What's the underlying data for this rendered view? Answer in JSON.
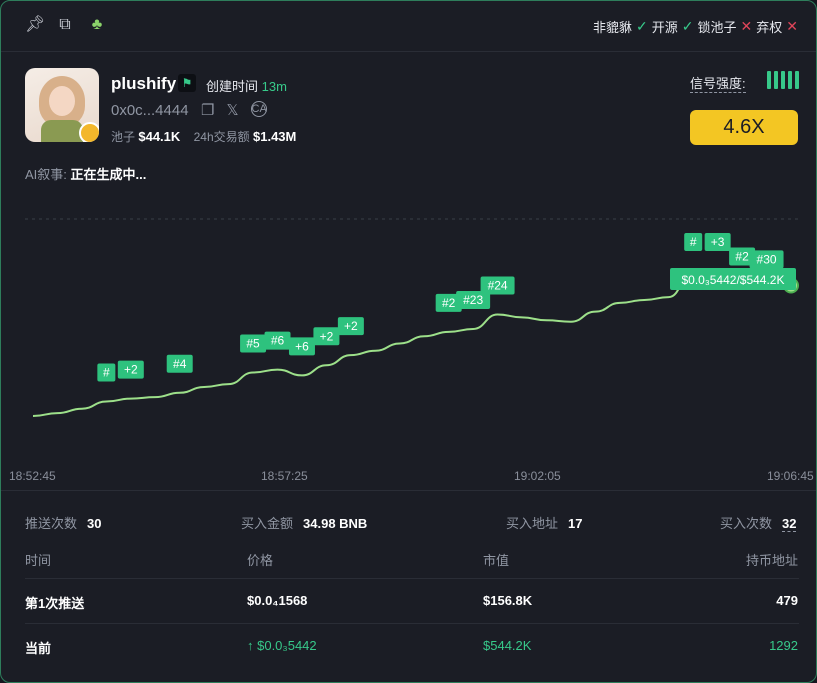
{
  "topbar": {
    "pin_icon": "pin-icon",
    "open_icon": "external-link-icon",
    "frog_icon": "frog-icon",
    "flags": [
      {
        "label": "非貔貅",
        "status": "ok"
      },
      {
        "label": "开源",
        "status": "ok"
      },
      {
        "label": "锁池子",
        "status": "no"
      },
      {
        "label": "弃权",
        "status": "no"
      }
    ],
    "ok_mark": "✓",
    "no_mark": "✕"
  },
  "token": {
    "name": "plushify",
    "created_label": "创建时间",
    "created_value": "13m",
    "address": "0x0c...4444",
    "pool_label": "池子",
    "pool_value": "$44.1K",
    "volume_label": "24h交易额",
    "volume_value": "$1.43M"
  },
  "signal": {
    "label": "信号强度:",
    "multiplier": "4.6X"
  },
  "ai": {
    "label": "AI叙事:",
    "value": "正在生成中..."
  },
  "chart_data": {
    "type": "line",
    "x_ticks": [
      "18:52:45",
      "18:57:25",
      "19:02:05",
      "19:06:45"
    ],
    "price_tag": "$0.0₃5442/$544.2K",
    "markers": [
      "#",
      "+2",
      "#4",
      "#5",
      "#6",
      "+6",
      "+2",
      "+2",
      "#2",
      "#23",
      "#24",
      "#",
      "+3",
      "#2",
      "#30"
    ],
    "series_values": [
      0.0,
      0.02,
      0.05,
      0.1,
      0.12,
      0.13,
      0.16,
      0.2,
      0.22,
      0.3,
      0.32,
      0.28,
      0.35,
      0.42,
      0.45,
      0.5,
      0.55,
      0.58,
      0.6,
      0.7,
      0.68,
      0.66,
      0.65,
      0.72,
      0.78,
      0.8,
      0.82,
      1.0,
      1.0,
      0.9,
      0.88,
      0.9
    ]
  },
  "summary": {
    "push_label": "推送次数",
    "push_value": "30",
    "buy_amount_label": "买入金额",
    "buy_amount_value": "34.98 BNB",
    "buy_addr_label": "买入地址",
    "buy_addr_value": "17",
    "buy_count_label": "买入次数",
    "buy_count_value": "32"
  },
  "table": {
    "headers": [
      "时间",
      "价格",
      "市值",
      "持币地址"
    ],
    "rows": [
      {
        "time": "第1次推送",
        "price": "$0.0₄1568",
        "mcap": "$156.8K",
        "holders": "479"
      },
      {
        "time": "当前",
        "price": "↑ $0.0₃5442",
        "mcap": "$544.2K",
        "holders": "1292"
      }
    ]
  }
}
